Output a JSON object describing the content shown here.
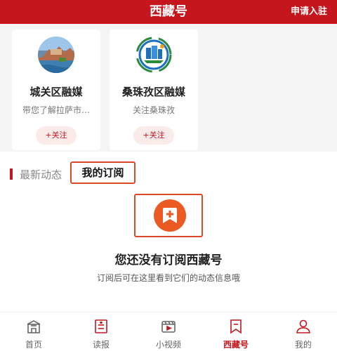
{
  "header": {
    "title": "西藏号",
    "action": "申请入驻"
  },
  "cards": [
    {
      "name": "城关区融媒",
      "description": "带您了解拉萨市…",
      "follow_label": "+关注"
    },
    {
      "name": "桑珠孜区融媒",
      "description": "关注桑珠孜",
      "follow_label": "+关注"
    }
  ],
  "tabs": {
    "latest": "最新动态",
    "mine": "我的订阅"
  },
  "empty_state": {
    "title": "您还没有订阅西藏号",
    "subtitle": "订阅后可在这里看到它们的动态信息哦"
  },
  "bottom_nav": [
    {
      "label": "首页",
      "icon": "home-icon"
    },
    {
      "label": "读报",
      "icon": "newspaper-icon"
    },
    {
      "label": "小视频",
      "icon": "video-icon"
    },
    {
      "label": "西藏号",
      "icon": "tibet-account-icon",
      "active": true
    },
    {
      "label": "我的",
      "icon": "profile-icon"
    }
  ],
  "colors": {
    "brand_red": "#c4161c",
    "highlight_orange": "#d84a2a",
    "empty_icon_orange": "#ea5a22"
  }
}
